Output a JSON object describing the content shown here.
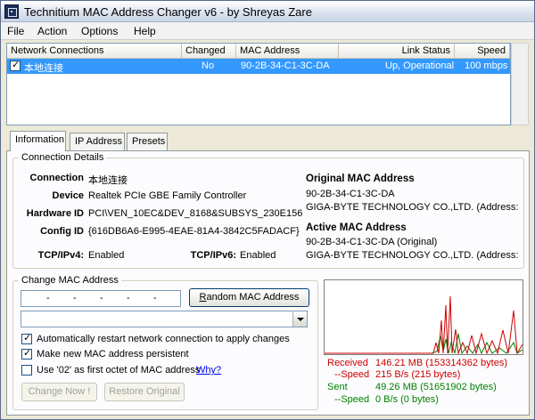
{
  "window": {
    "title": "Technitium MAC Address Changer v6 - by Shreyas Zare"
  },
  "menu": {
    "items": [
      "File",
      "Action",
      "Options",
      "Help"
    ]
  },
  "table": {
    "headers": {
      "connection": "Network Connections",
      "changed": "Changed",
      "mac": "MAC Address",
      "status": "Link Status",
      "speed": "Speed"
    },
    "rows": [
      {
        "checked": true,
        "name": "本地连接",
        "changed": "No",
        "mac": "90-2B-34-C1-3C-DA",
        "status": "Up, Operational",
        "speed": "100 mbps"
      }
    ]
  },
  "tabs": [
    "Information",
    "IP Address",
    "Presets"
  ],
  "details": {
    "legend": "Connection Details",
    "labels": {
      "connection": "Connection",
      "device": "Device",
      "hardware_id": "Hardware ID",
      "config_id": "Config ID",
      "tcpipv4": "TCP/IPv4:",
      "tcpipv6": "TCP/IPv6:"
    },
    "values": {
      "connection": "本地连接",
      "device": "Realtek PCIe GBE Family Controller",
      "hardware_id": "PCI\\VEN_10EC&DEV_8168&SUBSYS_230E156",
      "config_id": "{616DB6A6-E995-4EAE-81A4-3842C5FADACF}",
      "tcpipv4": "Enabled",
      "tcpipv6": "Enabled"
    },
    "original_mac": {
      "title": "Original MAC Address",
      "mac": "90-2B-34-C1-3C-DA",
      "vendor": "GIGA-BYTE TECHNOLOGY CO.,LTD.  (Address: F"
    },
    "active_mac": {
      "title": "Active MAC Address",
      "mac": "90-2B-34-C1-3C-DA (Original)",
      "vendor": "GIGA-BYTE TECHNOLOGY CO.,LTD.  (Address: F"
    }
  },
  "change": {
    "legend": "Change MAC Address",
    "mac_separator": "-",
    "random_button": "Random MAC Address",
    "random_button_mnemonic": "R",
    "random_button_rest": "andom MAC Address",
    "options": [
      {
        "checked": true,
        "label": "Automatically restart network connection to apply changes"
      },
      {
        "checked": true,
        "label": "Make new MAC address persistent"
      },
      {
        "checked": false,
        "label": "Use '02' as first octet of MAC address",
        "link": "Why?"
      }
    ],
    "change_now": "Change Now !",
    "restore_original": "Restore Original"
  },
  "traffic": {
    "received_label": "Received",
    "received_value": "146.21 MB (153314362 bytes)",
    "received_speed_label": "--Speed",
    "received_speed_value": "215 B/s (215 bytes)",
    "sent_label": "Sent",
    "sent_value": "49.26 MB (51651902 bytes)",
    "sent_speed_label": "--Speed",
    "sent_speed_value": "0 B/s (0 bytes)",
    "colors": {
      "received": "#cc0000",
      "sent": "#008000"
    }
  }
}
